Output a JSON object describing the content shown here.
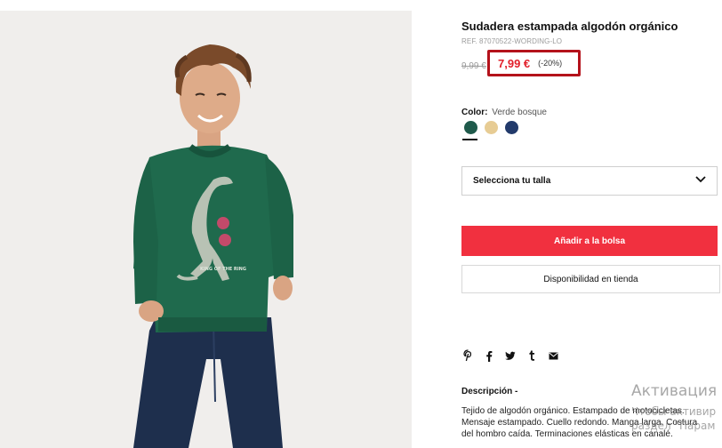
{
  "product": {
    "title": "Sudadera estampada algodón orgánico",
    "ref": "REF. 87070522-WORDING-LO",
    "old_price": "9,99 €",
    "new_price": "7,99 €",
    "discount": "(-20%)",
    "image": {
      "alt": "Niño con sudadera verde estampada con dinosaurio",
      "print_text": "KING OF THE RING"
    }
  },
  "color": {
    "label": "Color:",
    "selected": "Verde bosque",
    "swatches": [
      {
        "name": "Verde bosque",
        "hex": "#1f5a4b",
        "selected": true
      },
      {
        "name": "Beige",
        "hex": "#e7cc94",
        "selected": false
      },
      {
        "name": "Azul marino",
        "hex": "#223a6b",
        "selected": false
      }
    ]
  },
  "size": {
    "placeholder": "Selecciona tu talla",
    "icon": "chevron-down-icon"
  },
  "actions": {
    "add_to_bag": "Añadir a la bolsa",
    "store_availability": "Disponibilidad en tienda"
  },
  "share": {
    "icons": [
      "pinterest-icon",
      "facebook-icon",
      "twitter-icon",
      "tumblr-icon",
      "email-icon"
    ]
  },
  "description": {
    "title": "Descripción -",
    "lines": [
      "Tejido de algodón orgánico. Estampado de motocicletas.",
      "Mensaje estampado. Cuello redondo. Manga larga. Costura",
      "del hombro caída. Terminaciones elásticas en canalé."
    ]
  },
  "watermark": {
    "title": "Активация",
    "line1": "Чтобы активир",
    "line2": "раздел \"Парам"
  },
  "colors": {
    "accent_red": "#f1303f",
    "price_red": "#e2202b",
    "highlight_box": "#b4121b",
    "sweater_green": "#1f6a4d",
    "jeans_blue": "#1e2f4d"
  }
}
